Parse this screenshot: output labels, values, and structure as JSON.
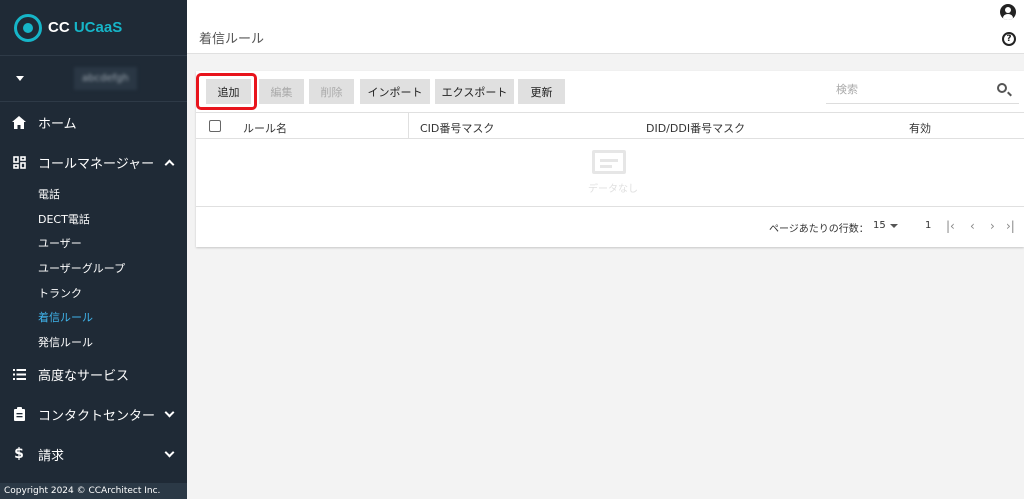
{
  "sidebar": {
    "logo_cc": "CC",
    "logo_ucaas": "UCaaS",
    "account_name": "abcdefgh",
    "nav": {
      "home": "ホーム",
      "call_manager": "コールマネージャー",
      "advanced": "高度なサービス",
      "contact_center": "コンタクトセンター",
      "billing": "請求"
    },
    "sub_items": [
      "電話",
      "DECT電話",
      "ユーザー",
      "ユーザーグループ",
      "トランク",
      "着信ルール",
      "発信ルール"
    ],
    "footer": "Copyright 2024 © CCArchitect Inc."
  },
  "header": {
    "title": "着信ルール"
  },
  "toolbar": {
    "add": "追加",
    "edit": "編集",
    "delete": "削除",
    "import": "インポート",
    "export": "エクスポート",
    "refresh": "更新",
    "search_placeholder": "検索"
  },
  "table": {
    "columns": [
      "ルール名",
      "CID番号マスク",
      "DID/DDI番号マスク",
      "有効"
    ],
    "empty_text": "データなし"
  },
  "pagination": {
    "rows_per_page_label": "ページあたりの行数：",
    "rows_per_page": "15",
    "page": "1"
  },
  "colors": {
    "sidebar_bg": "#1f2a36",
    "accent": "#16b5c8",
    "active": "#3fb3ea",
    "highlight": "#e8141c"
  }
}
